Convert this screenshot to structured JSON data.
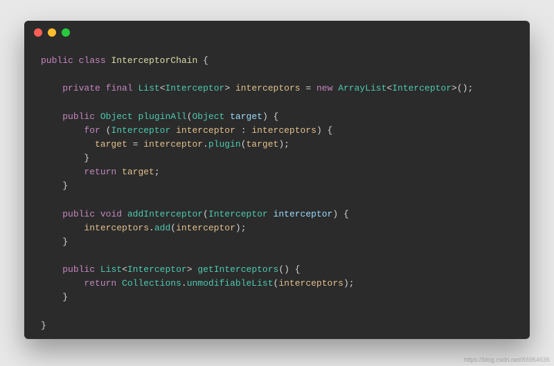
{
  "window": {
    "dots": [
      "red",
      "yellow",
      "green"
    ]
  },
  "code": {
    "tokens": [
      [
        [
          "kw",
          "public"
        ],
        [
          "op",
          " "
        ],
        [
          "kw",
          "class"
        ],
        [
          "op",
          " "
        ],
        [
          "cls",
          "InterceptorChain"
        ],
        [
          "op",
          " "
        ],
        [
          "punc",
          "{"
        ]
      ],
      [
        [
          "op",
          ""
        ]
      ],
      [
        [
          "op",
          "    "
        ],
        [
          "kw",
          "private"
        ],
        [
          "op",
          " "
        ],
        [
          "kw",
          "final"
        ],
        [
          "op",
          " "
        ],
        [
          "type",
          "List"
        ],
        [
          "punc",
          "<"
        ],
        [
          "type",
          "Interceptor"
        ],
        [
          "punc",
          "> "
        ],
        [
          "var",
          "interceptors"
        ],
        [
          "op",
          " = "
        ],
        [
          "kw",
          "new"
        ],
        [
          "op",
          " "
        ],
        [
          "type",
          "ArrayList"
        ],
        [
          "punc",
          "<"
        ],
        [
          "type",
          "Interceptor"
        ],
        [
          "punc",
          ">();"
        ]
      ],
      [
        [
          "op",
          ""
        ]
      ],
      [
        [
          "op",
          "    "
        ],
        [
          "kw",
          "public"
        ],
        [
          "op",
          " "
        ],
        [
          "type",
          "Object"
        ],
        [
          "op",
          " "
        ],
        [
          "fn",
          "pluginAll"
        ],
        [
          "punc",
          "("
        ],
        [
          "type",
          "Object"
        ],
        [
          "op",
          " "
        ],
        [
          "param",
          "target"
        ],
        [
          "punc",
          ") {"
        ]
      ],
      [
        [
          "op",
          "        "
        ],
        [
          "kw",
          "for"
        ],
        [
          "op",
          " "
        ],
        [
          "punc",
          "("
        ],
        [
          "type",
          "Interceptor"
        ],
        [
          "op",
          " "
        ],
        [
          "var",
          "interceptor"
        ],
        [
          "op",
          " : "
        ],
        [
          "var",
          "interceptors"
        ],
        [
          "punc",
          ") {"
        ]
      ],
      [
        [
          "op",
          "          "
        ],
        [
          "var",
          "target"
        ],
        [
          "op",
          " = "
        ],
        [
          "var",
          "interceptor"
        ],
        [
          "punc",
          "."
        ],
        [
          "fn",
          "plugin"
        ],
        [
          "punc",
          "("
        ],
        [
          "var",
          "target"
        ],
        [
          "punc",
          ");"
        ]
      ],
      [
        [
          "op",
          "        "
        ],
        [
          "punc",
          "}"
        ]
      ],
      [
        [
          "op",
          "        "
        ],
        [
          "kw",
          "return"
        ],
        [
          "op",
          " "
        ],
        [
          "var",
          "target"
        ],
        [
          "punc",
          ";"
        ]
      ],
      [
        [
          "op",
          "    "
        ],
        [
          "punc",
          "}"
        ]
      ],
      [
        [
          "op",
          ""
        ]
      ],
      [
        [
          "op",
          "    "
        ],
        [
          "kw",
          "public"
        ],
        [
          "op",
          " "
        ],
        [
          "kw",
          "void"
        ],
        [
          "op",
          " "
        ],
        [
          "fn",
          "addInterceptor"
        ],
        [
          "punc",
          "("
        ],
        [
          "type",
          "Interceptor"
        ],
        [
          "op",
          " "
        ],
        [
          "param",
          "interceptor"
        ],
        [
          "punc",
          ") {"
        ]
      ],
      [
        [
          "op",
          "        "
        ],
        [
          "var",
          "interceptors"
        ],
        [
          "punc",
          "."
        ],
        [
          "fn",
          "add"
        ],
        [
          "punc",
          "("
        ],
        [
          "var",
          "interceptor"
        ],
        [
          "punc",
          ");"
        ]
      ],
      [
        [
          "op",
          "    "
        ],
        [
          "punc",
          "}"
        ]
      ],
      [
        [
          "op",
          ""
        ]
      ],
      [
        [
          "op",
          "    "
        ],
        [
          "kw",
          "public"
        ],
        [
          "op",
          " "
        ],
        [
          "type",
          "List"
        ],
        [
          "punc",
          "<"
        ],
        [
          "type",
          "Interceptor"
        ],
        [
          "punc",
          "> "
        ],
        [
          "fn",
          "getInterceptors"
        ],
        [
          "punc",
          "() {"
        ]
      ],
      [
        [
          "op",
          "        "
        ],
        [
          "kw",
          "return"
        ],
        [
          "op",
          " "
        ],
        [
          "type",
          "Collections"
        ],
        [
          "punc",
          "."
        ],
        [
          "fn",
          "unmodifiableList"
        ],
        [
          "punc",
          "("
        ],
        [
          "var",
          "interceptors"
        ],
        [
          "punc",
          ");"
        ]
      ],
      [
        [
          "op",
          "    "
        ],
        [
          "punc",
          "}"
        ]
      ],
      [
        [
          "op",
          ""
        ]
      ],
      [
        [
          "punc",
          "}"
        ]
      ]
    ]
  },
  "watermark": "https://blog.csdn.net/X6954636"
}
